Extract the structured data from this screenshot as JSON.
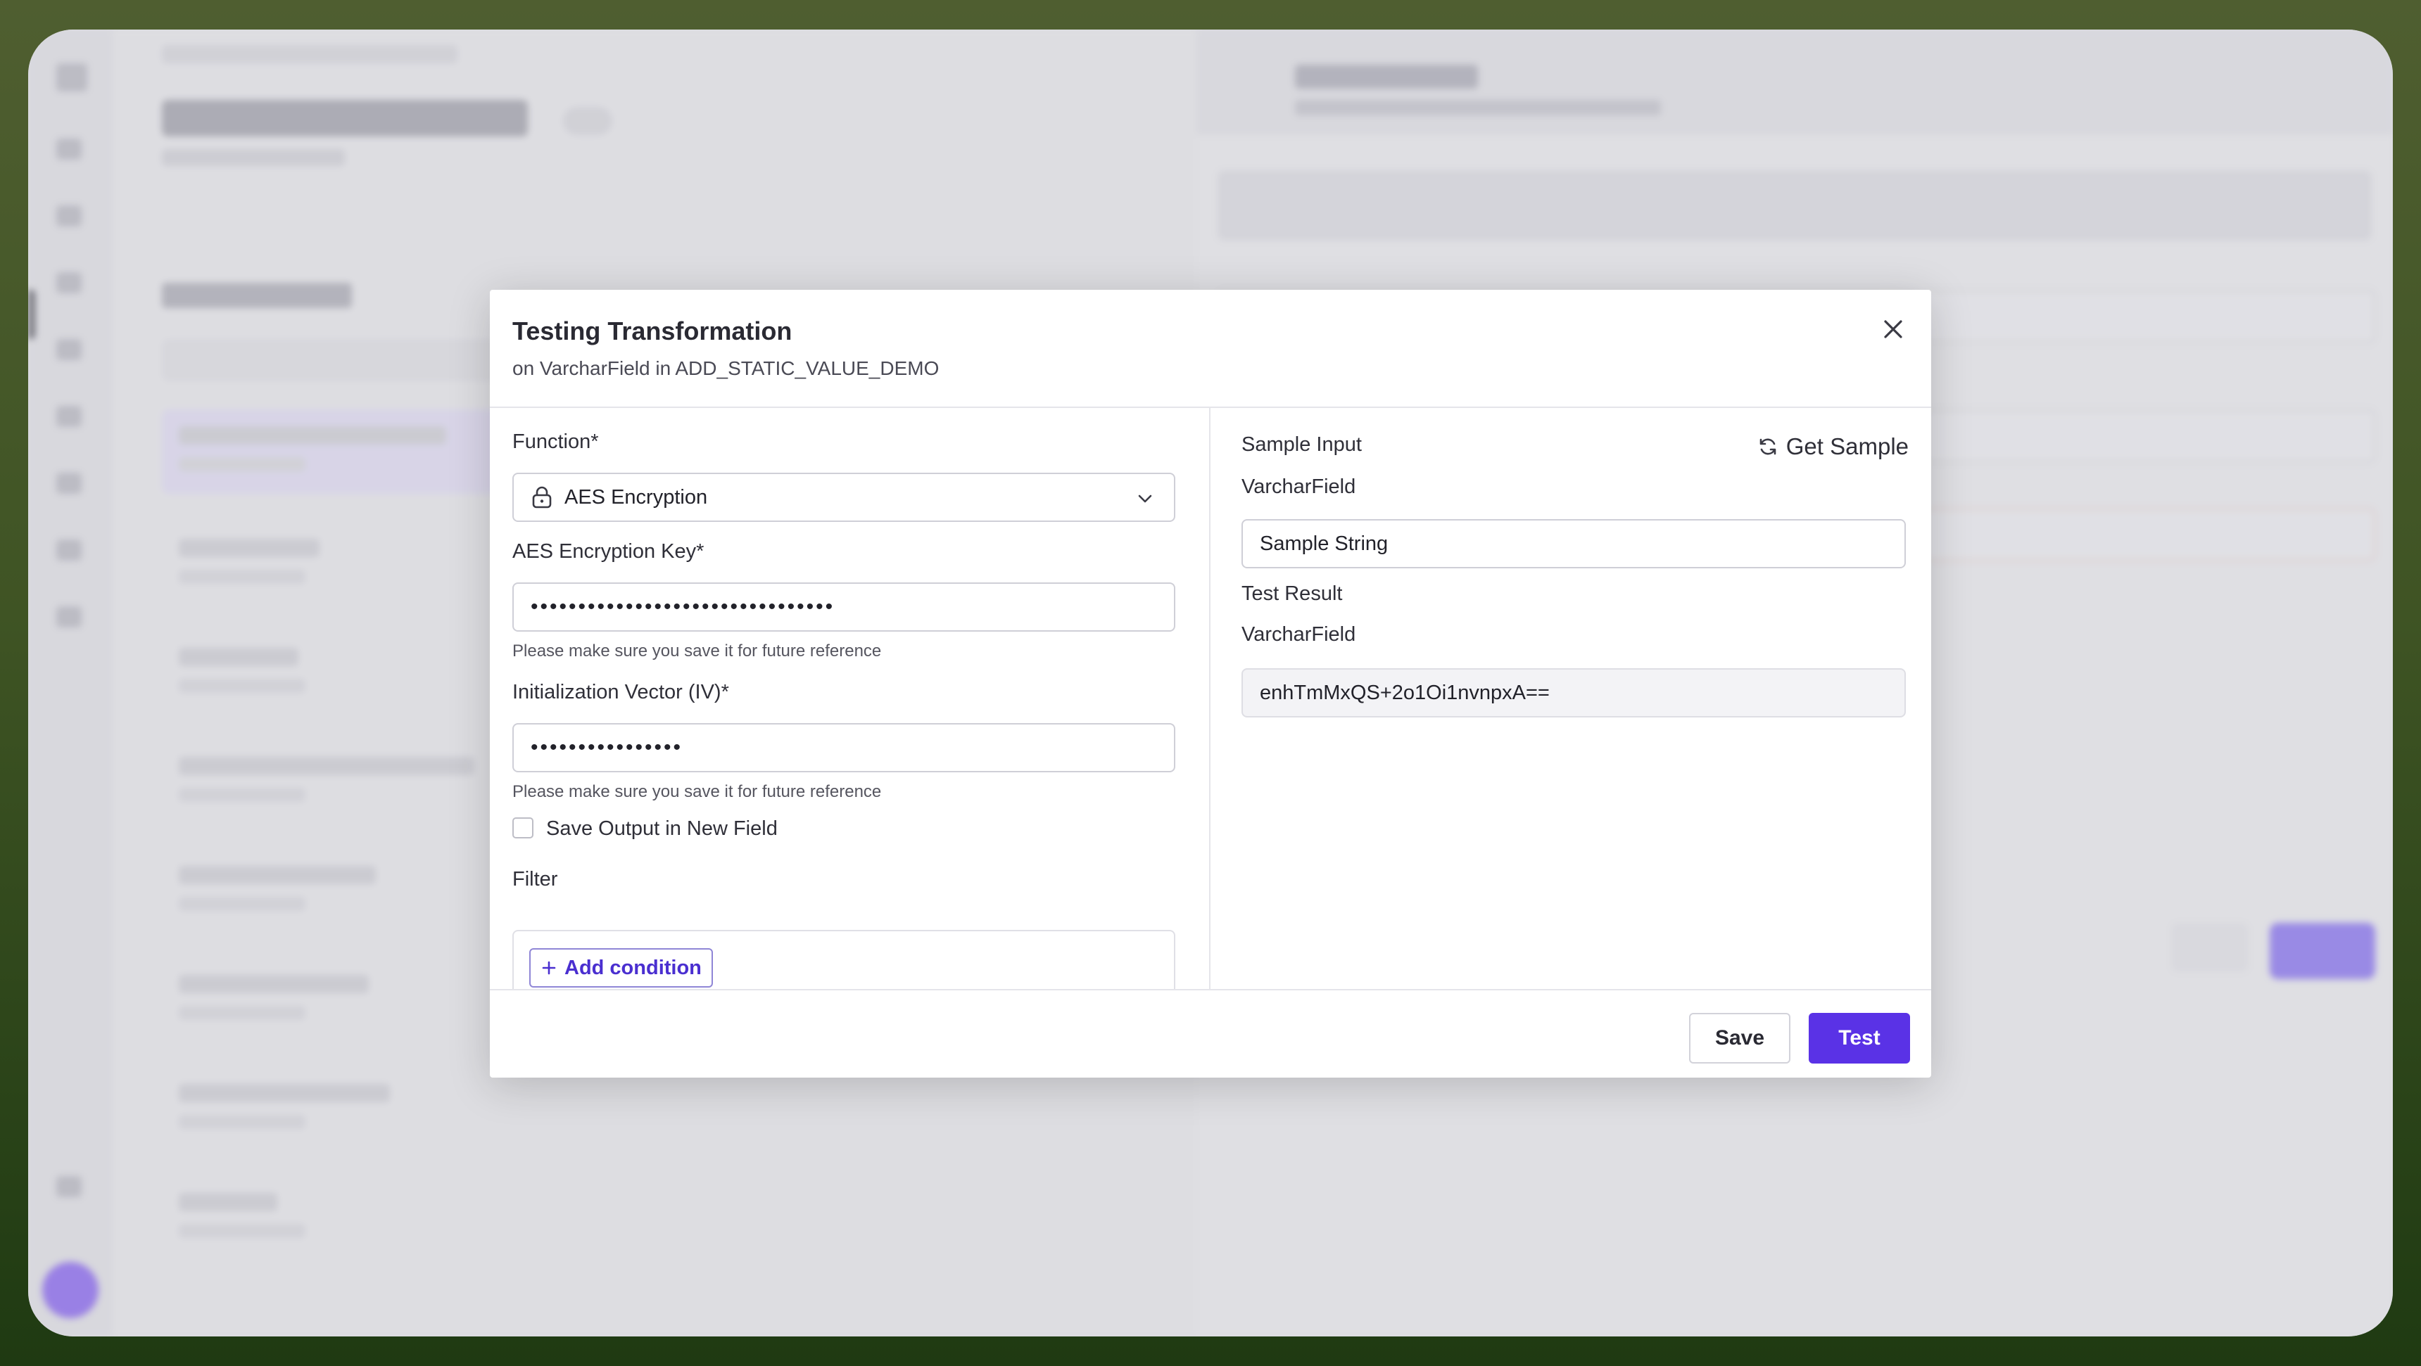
{
  "modal": {
    "title": "Testing Transformation",
    "subtitle": "on VarcharField in ADD_STATIC_VALUE_DEMO",
    "close_icon": "close-icon"
  },
  "form": {
    "function_label": "Function*",
    "function_value": "AES Encryption",
    "function_icon": "lock-icon",
    "aes_key_label": "AES Encryption Key*",
    "aes_key_value": "••••••••••••••••••••••••••••••••",
    "aes_key_help": "Please make sure you save it for future reference",
    "iv_label": "Initialization Vector (IV)*",
    "iv_value": "••••••••••••••••",
    "iv_help": "Please make sure you save it for future reference",
    "save_output_label": "Save Output in New Field",
    "save_output_checked": false,
    "filter_label": "Filter",
    "add_condition_label": "Add condition"
  },
  "sample": {
    "input_heading": "Sample Input",
    "get_sample_label": "Get Sample",
    "input_field_label": "VarcharField",
    "input_value": "Sample String",
    "result_heading": "Test Result",
    "result_field_label": "VarcharField",
    "result_value": "enhTmMxQS+2o1Oi1nvnpxA=="
  },
  "footer": {
    "save_label": "Save",
    "test_label": "Test"
  },
  "colors": {
    "primary": "#5a32e6",
    "backdrop_top": "#4f5e30",
    "backdrop_bottom": "#1f3a12"
  }
}
